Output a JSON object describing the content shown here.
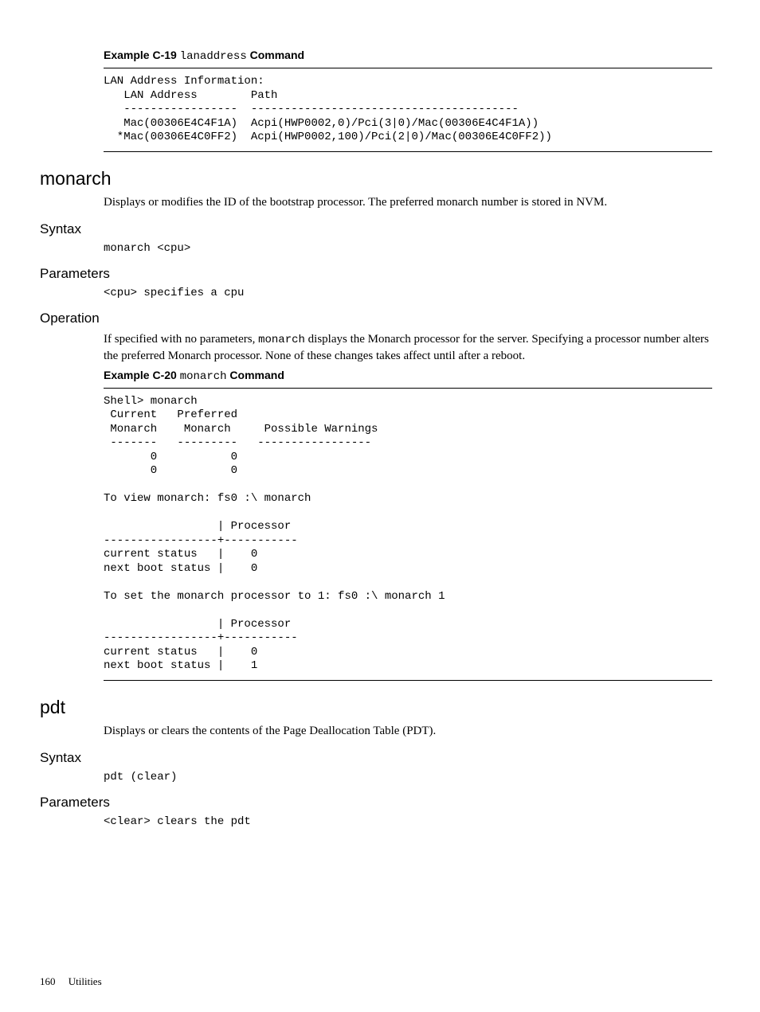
{
  "example19": {
    "label_prefix": "Example C-19",
    "code_word": "lanaddress",
    "label_suffix": "Command",
    "content": "LAN Address Information:\n   LAN Address        Path\n   -----------------  ----------------------------------------\n   Mac(00306E4C4F1A)  Acpi(HWP0002,0)/Pci(3|0)/Mac(00306E4C4F1A))\n  *Mac(00306E4C0FF2)  Acpi(HWP0002,100)/Pci(2|0)/Mac(00306E4C0FF2))"
  },
  "monarch": {
    "title": "monarch",
    "desc": "Displays or modifies the ID of the bootstrap processor. The preferred monarch number is stored in NVM.",
    "syntax_title": "Syntax",
    "syntax": "monarch <cpu>",
    "parameters_title": "Parameters",
    "parameters": "<cpu>      specifies a cpu",
    "operation_title": "Operation",
    "operation_pre": "If specified with no parameters, ",
    "operation_code": "monarch",
    "operation_post": " displays the Monarch processor for the server. Specifying a processor number alters the preferred Monarch processor. None of these changes takes affect until after a reboot."
  },
  "example20": {
    "label_prefix": "Example C-20",
    "code_word": "monarch",
    "label_suffix": "Command",
    "content": "Shell> monarch\n Current   Preferred\n Monarch    Monarch     Possible Warnings\n -------   ---------   -----------------\n       0           0\n       0           0\n\nTo view monarch: fs0 :\\ monarch\n\n                 | Processor\n-----------------+-----------\ncurrent status   |    0\nnext boot status |    0\n\nTo set the monarch processor to 1: fs0 :\\ monarch 1\n\n                 | Processor\n-----------------+-----------\ncurrent status   |    0\nnext boot status |    1"
  },
  "pdt": {
    "title": "pdt",
    "desc": "Displays or clears the contents of the Page Deallocation Table (PDT).",
    "syntax_title": "Syntax",
    "syntax": "pdt (clear)",
    "parameters_title": "Parameters",
    "parameters": "<clear>      clears the pdt"
  },
  "footer": {
    "page": "160",
    "section": "Utilities"
  }
}
